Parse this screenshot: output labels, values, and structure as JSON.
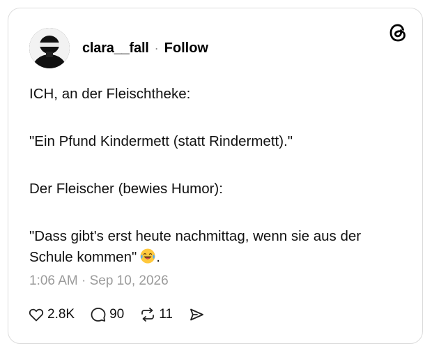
{
  "post": {
    "username": "clara__fall",
    "separator": "·",
    "follow_label": "Follow",
    "lines": [
      "ICH, an der Fleischtheke:",
      "\"Ein Pfund Kindermett (statt Rindermett).\"",
      "Der Fleischer (bewies Humor):",
      "\"Dass gibt's erst heute nachmittag, wenn sie aus der Schule kommen\""
    ],
    "last_line_suffix": ".",
    "timestamp": "1:06 AM · Sep 10, 2026"
  },
  "actions": {
    "likes": "2.8K",
    "replies": "90",
    "reposts": "11"
  },
  "icons": {
    "brand": "threads-logo-icon",
    "emoji": "laughing-tears-emoji",
    "like": "heart-icon",
    "reply": "speech-bubble-icon",
    "repost": "repost-icon",
    "share": "send-icon"
  }
}
